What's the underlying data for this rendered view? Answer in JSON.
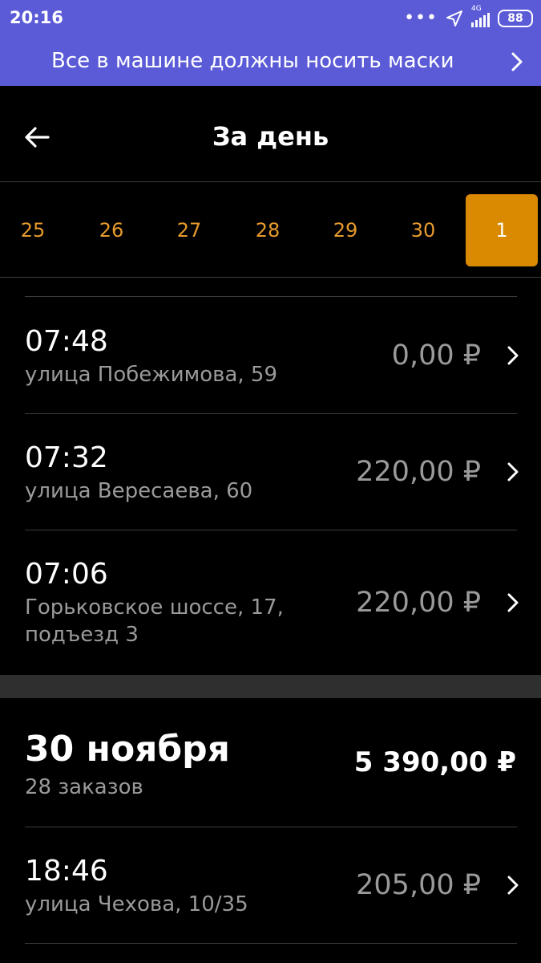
{
  "status": {
    "time": "20:16",
    "network": "4G",
    "battery": "88"
  },
  "banner": {
    "text": "Все в машине должны носить маски"
  },
  "header": {
    "title": "За день"
  },
  "dates": [
    "25",
    "26",
    "27",
    "28",
    "29",
    "30",
    "1"
  ],
  "selected_date": "1",
  "orders_today": [
    {
      "time": "07:48",
      "address": "улица Побежимова, 59",
      "price": "0,00 ₽"
    },
    {
      "time": "07:32",
      "address": "улица Вересаева, 60",
      "price": "220,00 ₽"
    },
    {
      "time": "07:06",
      "address": "Горьковское шоссе, 17, подъезд 3",
      "price": "220,00 ₽"
    }
  ],
  "day": {
    "title": "30 ноября",
    "count": "28 заказов",
    "total": "5 390,00 ₽"
  },
  "orders_prev": [
    {
      "time": "18:46",
      "address": "улица Чехова, 10/35",
      "price": "205,00 ₽"
    }
  ],
  "colors": {
    "banner_bg": "#5b5bd8",
    "accent": "#d98a00",
    "date_text": "#e59a2e",
    "muted_text": "#9a9a9a"
  }
}
